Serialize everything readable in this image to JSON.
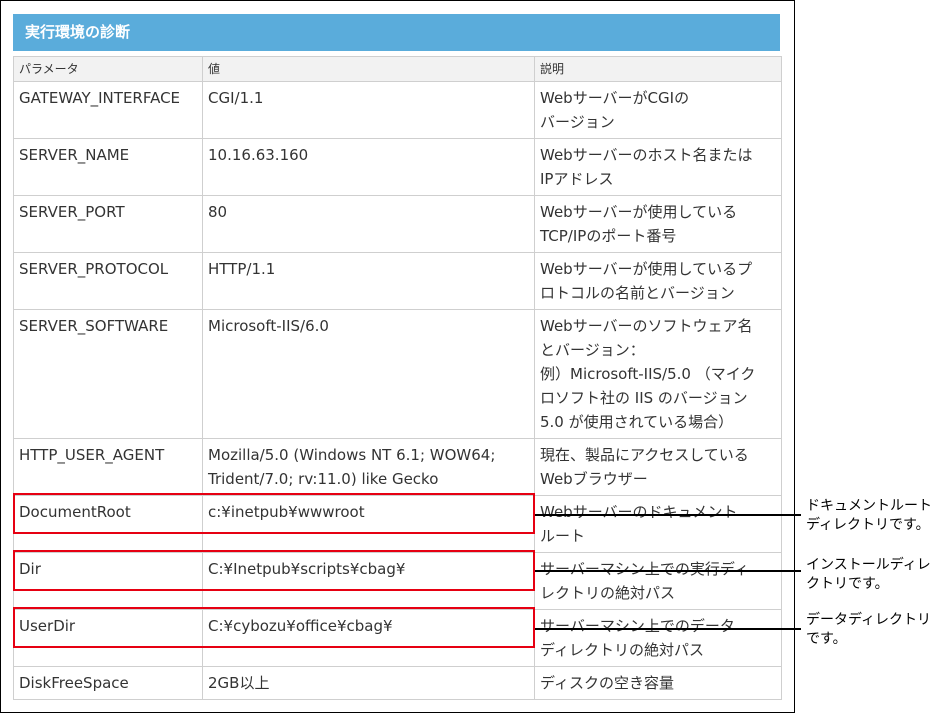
{
  "section_title": "実行環境の診断",
  "table": {
    "headers": [
      "パラメータ",
      "値",
      "説明"
    ],
    "rows": [
      {
        "param": "GATEWAY_INTERFACE",
        "value": "CGI/1.1",
        "desc": "WebサーバーがCGIの\nバージョン"
      },
      {
        "param": "SERVER_NAME",
        "value": "10.16.63.160",
        "desc": "Webサーバーのホスト名または\nIPアドレス"
      },
      {
        "param": "SERVER_PORT",
        "value": "80",
        "desc": "Webサーバーが使用している\nTCP/IPのポート番号"
      },
      {
        "param": "SERVER_PROTOCOL",
        "value": "HTTP/1.1",
        "desc": "Webサーバーが使用しているプ\nロトコルの名前とバージョン"
      },
      {
        "param": "SERVER_SOFTWARE",
        "value": "Microsoft-IIS/6.0",
        "desc": "Webサーバーのソフトウェア名\nとバージョン：\n例）Microsoft-IIS/5.0 （マイク\nロソフト社の IIS のバージョン\n5.0 が使用されている場合）"
      },
      {
        "param": "HTTP_USER_AGENT",
        "value": "Mozilla/5.0 (Windows NT 6.1; WOW64;\nTrident/7.0; rv:11.0) like Gecko",
        "desc": "現在、製品にアクセスしている\nWebブラウザー"
      },
      {
        "param": "DocumentRoot",
        "value": "c:¥inetpub¥wwwroot",
        "desc": "Webサーバーのドキュメント\nルート"
      },
      {
        "param": "Dir",
        "value": "C:¥Inetpub¥scripts¥cbag¥",
        "desc": "サーバーマシン上での実行ディ\nレクトリの絶対パス"
      },
      {
        "param": "UserDir",
        "value": "C:¥cybozu¥office¥cbag¥",
        "desc": "サーバーマシン上でのデータ\nディレクトリの絶対パス"
      },
      {
        "param": "DiskFreeSpace",
        "value": "2GB以上",
        "desc": "ディスクの空き容量"
      }
    ]
  },
  "callouts": [
    {
      "text": "ドキュメントルート\nディレクトリです。"
    },
    {
      "text": "インストールディレ\nクトリです。"
    },
    {
      "text": "データディレクトリ\nです。"
    }
  ],
  "colors": {
    "header_bg": "#5aacdb",
    "highlight": "#e60012"
  }
}
